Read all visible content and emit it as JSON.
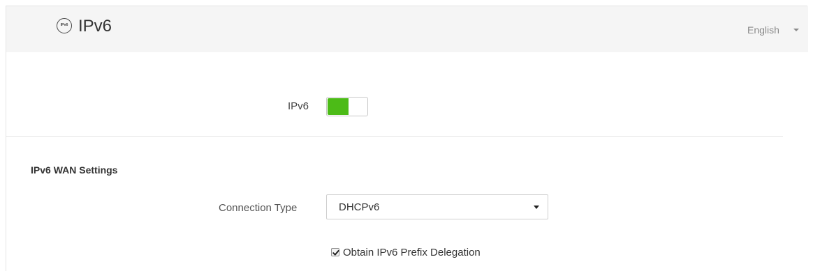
{
  "header": {
    "icon_text": "IPv6",
    "title": "IPv6",
    "language": "English"
  },
  "ipv6_toggle": {
    "label": "IPv6",
    "enabled": true,
    "on_color": "#4cbb17"
  },
  "wan_settings": {
    "section_title": "IPv6 WAN Settings",
    "connection_type_label": "Connection Type",
    "connection_type_value": "DHCPv6",
    "prefix_delegation_label": "Obtain IPv6 Prefix Delegation",
    "prefix_delegation_checked": true
  }
}
